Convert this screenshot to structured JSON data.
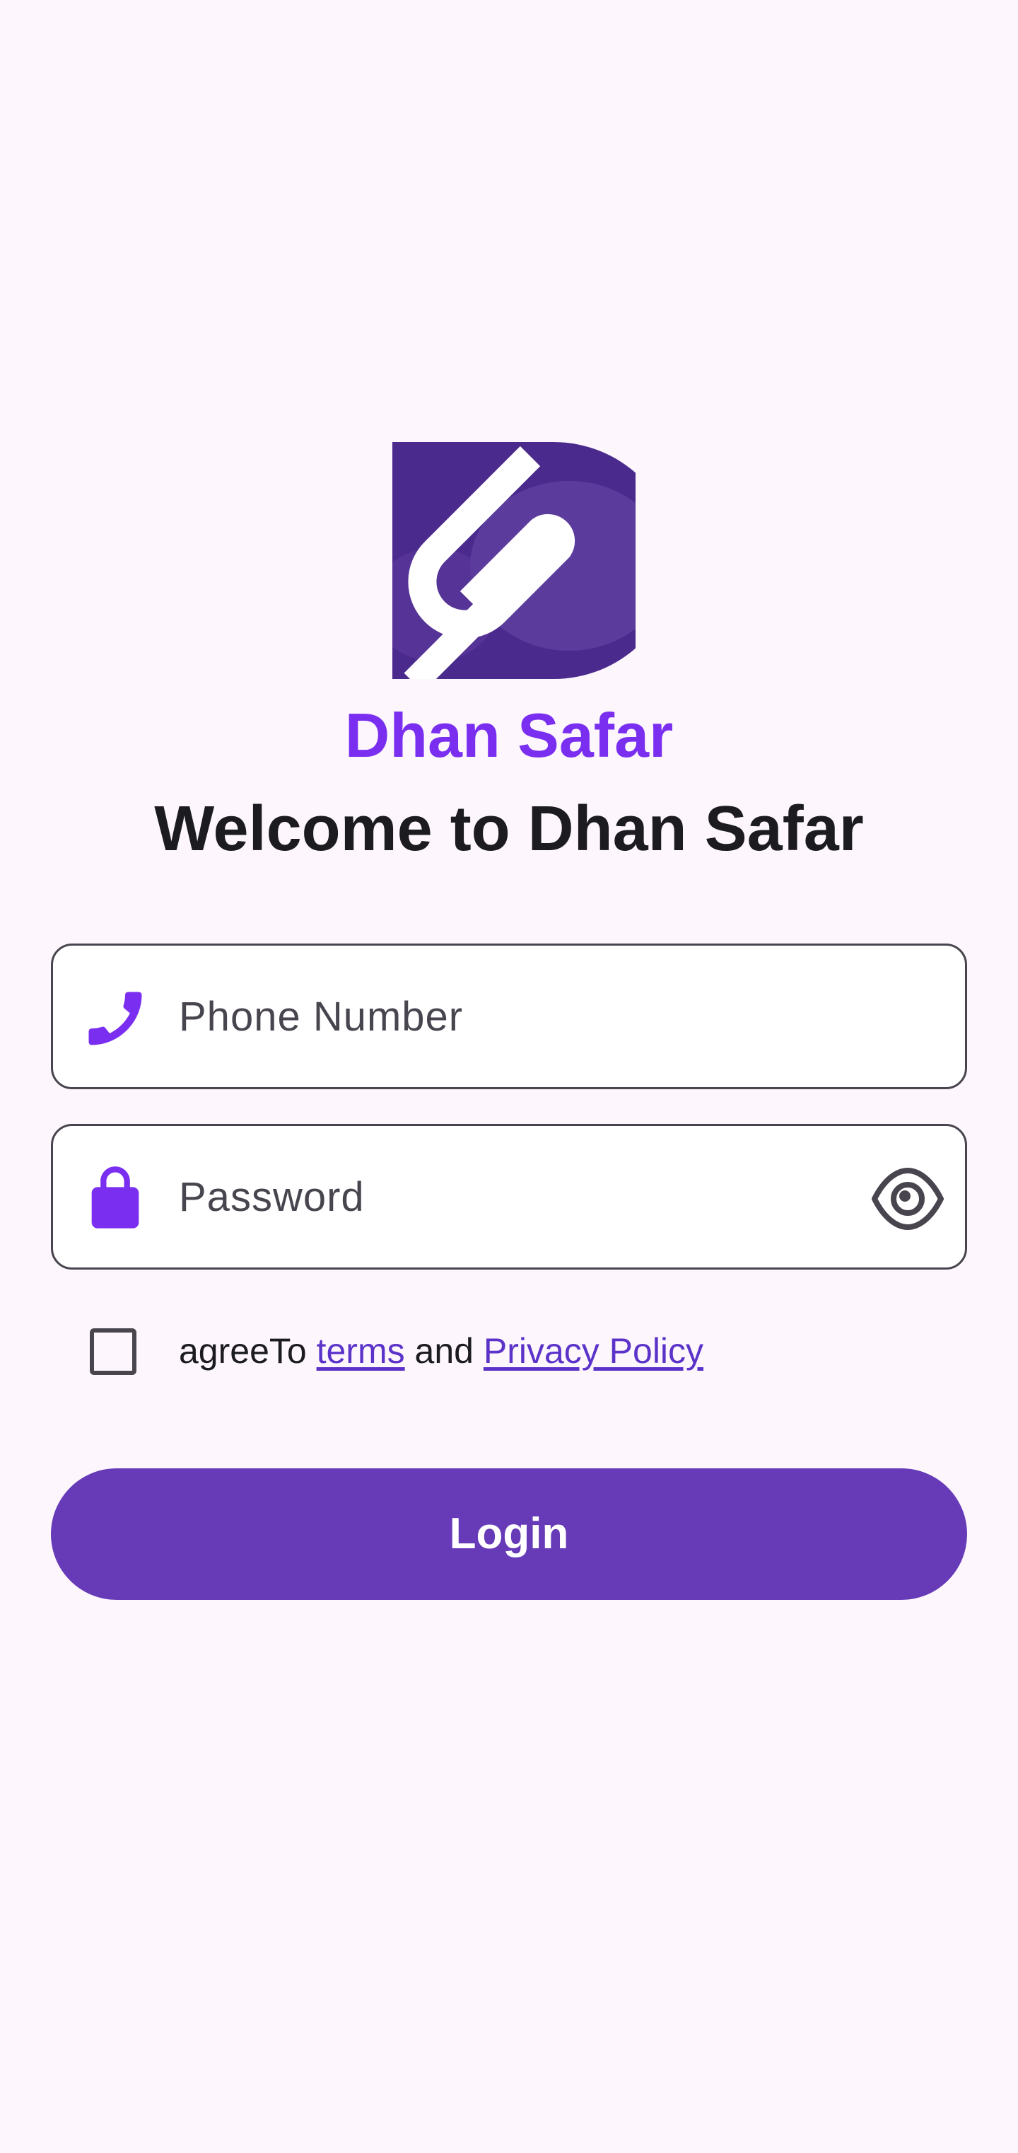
{
  "brand": {
    "app_name": "Dhan Safar",
    "logo_icon": "dhan-safar-logo",
    "accent_color": "#7a2ff0",
    "primary_color": "#673ab7"
  },
  "header": {
    "welcome_title": "Welcome to Dhan Safar"
  },
  "form": {
    "phone": {
      "placeholder": "Phone Number",
      "value": "",
      "icon": "phone-icon"
    },
    "password": {
      "placeholder": "Password",
      "value": "",
      "icon": "lock-icon",
      "toggle_icon": "eye-icon"
    },
    "agreement": {
      "checked": false,
      "prefix": "agreeTo",
      "terms_link": "terms",
      "conjunction": "and",
      "privacy_link": "Privacy Policy"
    },
    "login_label": "Login"
  }
}
